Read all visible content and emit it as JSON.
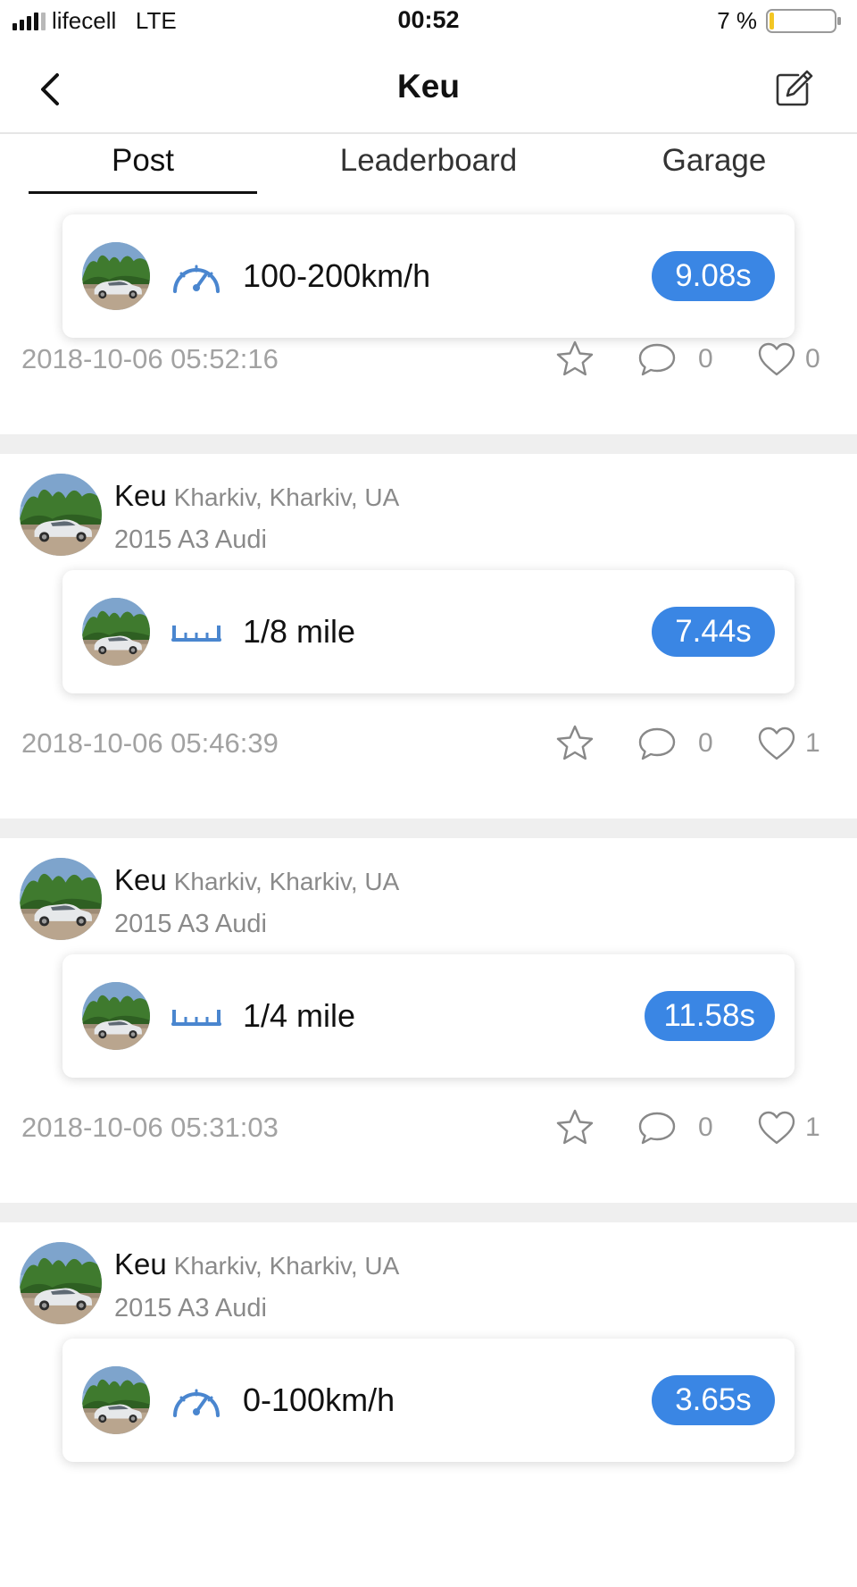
{
  "status_bar": {
    "carrier": "lifecell   LTE",
    "time": "00:52",
    "battery_percent": "7 %",
    "battery_level": 0.07,
    "signal_bars": 4
  },
  "nav": {
    "title": "Keu",
    "back_icon": "chevron-left-icon",
    "edit_icon": "edit-icon"
  },
  "tabs": [
    {
      "label": "Post",
      "active": true
    },
    {
      "label": "Leaderboard",
      "active": false
    },
    {
      "label": "Garage",
      "active": false
    }
  ],
  "colors": {
    "badge": "#3a86e4",
    "icon_blue": "#4a86cf",
    "muted_text": "#a2a2a2"
  },
  "posts": [
    {
      "result": {
        "label": "100-200km/h",
        "time": "9.08s",
        "icon": "speedometer-icon"
      },
      "timestamp": "2018-10-06 05:52:16",
      "comments": "0",
      "likes": "0"
    },
    {
      "user": {
        "name": "Keu",
        "location": "Kharkiv, Kharkiv, UA",
        "car": "2015 A3 Audi"
      },
      "result": {
        "label": "1/8 mile",
        "time": "7.44s",
        "icon": "ruler-icon"
      },
      "timestamp": "2018-10-06 05:46:39",
      "comments": "0",
      "likes": "1"
    },
    {
      "user": {
        "name": "Keu",
        "location": "Kharkiv, Kharkiv, UA",
        "car": "2015 A3 Audi"
      },
      "result": {
        "label": "1/4 mile",
        "time": "11.58s",
        "icon": "ruler-icon"
      },
      "timestamp": "2018-10-06 05:31:03",
      "comments": "0",
      "likes": "1"
    },
    {
      "user": {
        "name": "Keu",
        "location": "Kharkiv, Kharkiv, UA",
        "car": "2015 A3 Audi"
      },
      "result": {
        "label": "0-100km/h",
        "time": "3.65s",
        "icon": "speedometer-icon"
      }
    }
  ]
}
